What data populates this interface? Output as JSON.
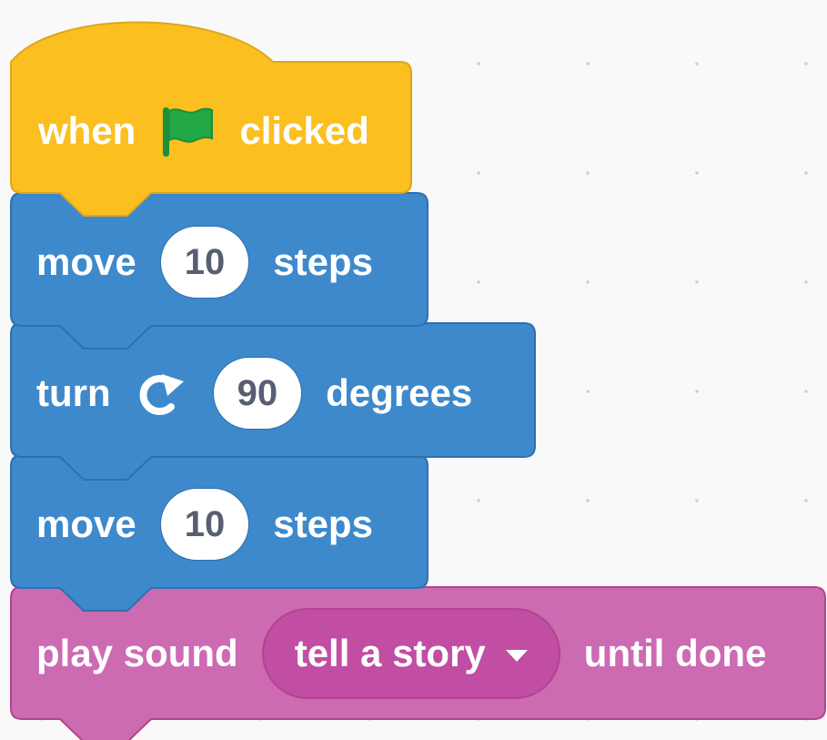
{
  "colors": {
    "events": "#fbbf1f",
    "events_border": "#dca81b",
    "motion": "#3e89cc",
    "motion_border": "#2f6fb0",
    "sound": "#cc6ab2",
    "sound_border": "#b2438f",
    "flag_green": "#22a846",
    "input_text": "#585e73"
  },
  "blocks": {
    "when_clicked": {
      "label_1": "when",
      "icon": "green-flag-icon",
      "label_2": "clicked"
    },
    "move_1": {
      "label": "move",
      "value": "10",
      "unit": "steps"
    },
    "turn": {
      "label": "turn",
      "icon": "rotate-clockwise-icon",
      "value": "90",
      "unit": "degrees"
    },
    "move_2": {
      "label": "move",
      "value": "10",
      "unit": "steps"
    },
    "play_sound": {
      "label": "play sound",
      "sound": "tell a story",
      "dropdown_icon": "dropdown-arrow-icon",
      "suffix": "until done"
    }
  }
}
